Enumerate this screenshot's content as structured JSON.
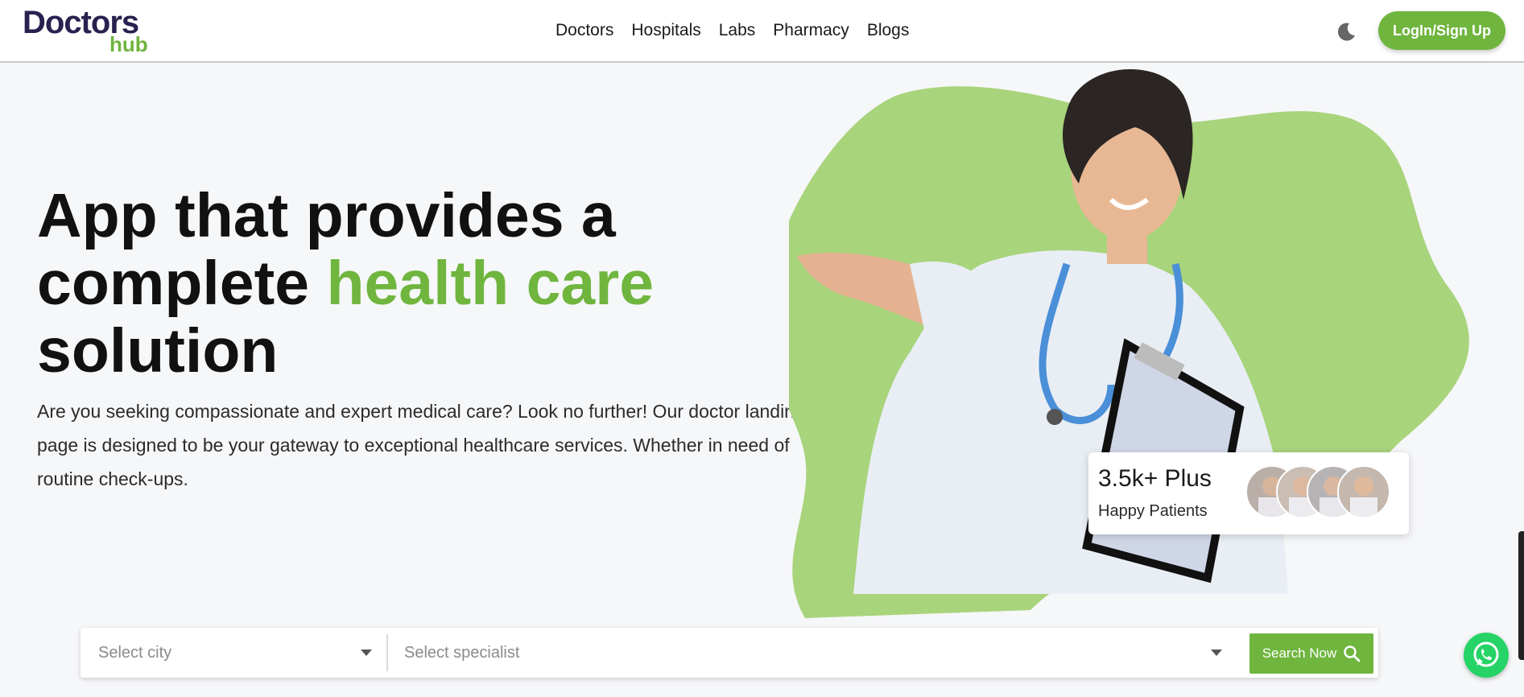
{
  "brand": {
    "logo_top": "Doctors",
    "logo_bottom": "hub",
    "accent_color": "#6fb53e"
  },
  "nav": {
    "items": [
      "Doctors",
      "Hospitals",
      "Labs",
      "Pharmacy",
      "Blogs"
    ]
  },
  "header": {
    "login_label": "LogIn/Sign Up",
    "theme_toggle_icon": "moon-icon"
  },
  "hero": {
    "title_part1": "App that provides a complete ",
    "title_accent": "health care",
    "title_part2": "solution",
    "description": "Are you seeking compassionate and expert medical care? Look no further! Our doctor landing page is designed to be your gateway to exceptional healthcare services. Whether in need of routine check-ups."
  },
  "stats": {
    "value": "3.5k+ Plus",
    "label": "Happy Patients",
    "avatar_count": 4
  },
  "search": {
    "city_placeholder": "Select city",
    "specialist_placeholder": "Select specialist",
    "button_label": "Search Now",
    "button_icon": "search-icon"
  },
  "floating": {
    "whatsapp_icon": "whatsapp-icon"
  }
}
